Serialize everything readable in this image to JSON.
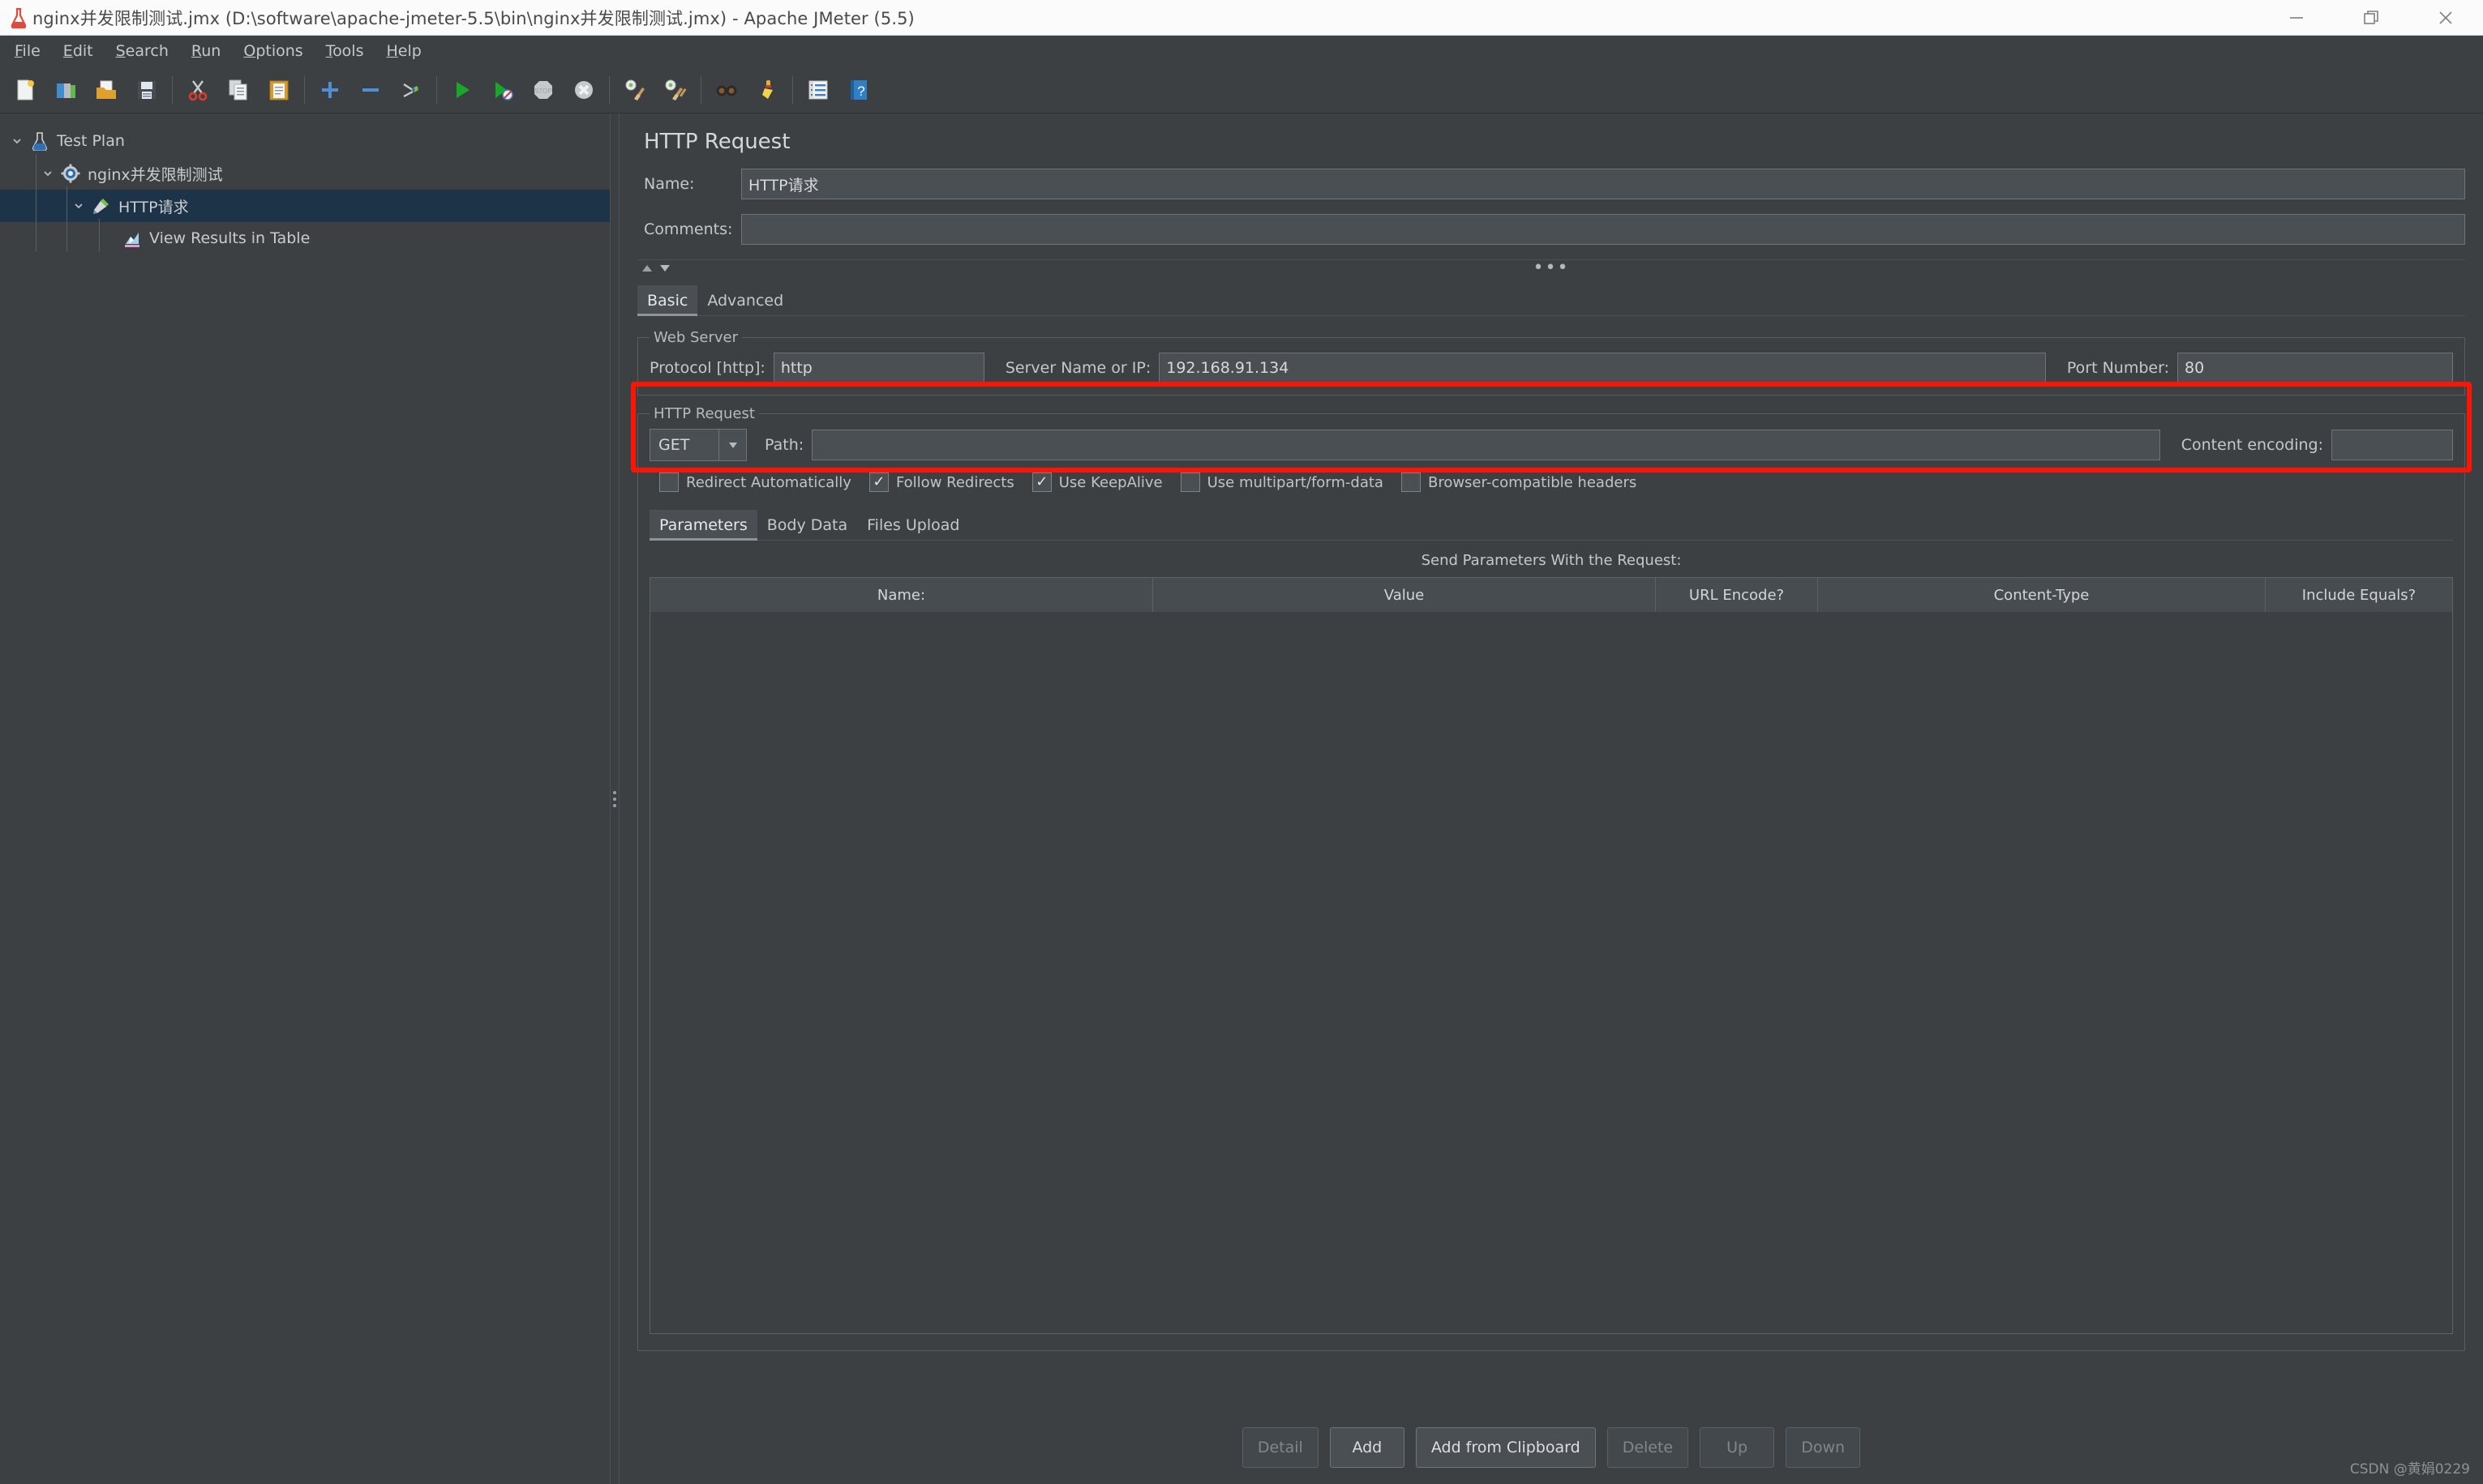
{
  "window": {
    "title": "nginx并发限制测试.jmx (D:\\software\\apache-jmeter-5.5\\bin\\nginx并发限制测试.jmx) - Apache JMeter (5.5)",
    "app_icon": "jmeter-icon",
    "controls": {
      "minimize": "minimize-icon",
      "restore": "restore-icon",
      "close": "close-icon"
    }
  },
  "menubar": {
    "items": [
      {
        "label": "File",
        "mnemonic": "F"
      },
      {
        "label": "Edit",
        "mnemonic": "E"
      },
      {
        "label": "Search",
        "mnemonic": "S"
      },
      {
        "label": "Run",
        "mnemonic": "R"
      },
      {
        "label": "Options",
        "mnemonic": "O"
      },
      {
        "label": "Tools",
        "mnemonic": "T"
      },
      {
        "label": "Help",
        "mnemonic": "H"
      }
    ]
  },
  "toolbar": {
    "groups": [
      [
        "new-test-plan-icon",
        "templates-icon",
        "open-icon",
        "save-icon"
      ],
      [
        "cut-icon",
        "copy-icon",
        "paste-icon"
      ],
      [
        "expand-all-icon",
        "collapse-all-icon",
        "toggle-icon"
      ],
      [
        "start-icon",
        "start-no-pauses-icon",
        "stop-icon",
        "shutdown-icon"
      ],
      [
        "clear-icon",
        "clear-all-icon"
      ],
      [
        "search-icon",
        "reset-search-icon"
      ],
      [
        "function-helper-icon",
        "help-icon"
      ]
    ]
  },
  "tree": {
    "nodes": [
      {
        "label": "Test Plan",
        "icon": "test-plan-icon",
        "depth": 0,
        "expanded": true,
        "selected": false
      },
      {
        "label": "nginx并发限制测试",
        "icon": "thread-group-icon",
        "depth": 1,
        "expanded": true,
        "selected": false
      },
      {
        "label": "HTTP请求",
        "icon": "http-sampler-icon",
        "depth": 2,
        "expanded": true,
        "selected": true
      },
      {
        "label": "View Results in Table",
        "icon": "view-results-table-icon",
        "depth": 3,
        "expanded": false,
        "selected": false
      }
    ]
  },
  "panel": {
    "title": "HTTP Request",
    "name_label": "Name:",
    "name_value": "HTTP请求",
    "comments_label": "Comments:",
    "comments_value": "",
    "collapse_dots": "•••",
    "tabs": [
      {
        "label": "Basic",
        "active": true
      },
      {
        "label": "Advanced",
        "active": false
      }
    ],
    "web_server": {
      "legend": "Web Server",
      "protocol_label": "Protocol [http]:",
      "protocol_value": "http",
      "server_label": "Server Name or IP:",
      "server_value": "192.168.91.134",
      "port_label": "Port Number:",
      "port_value": "80"
    },
    "http_request": {
      "legend": "HTTP Request",
      "method_value": "GET",
      "path_label": "Path:",
      "path_value": "",
      "content_encoding_label": "Content encoding:",
      "content_encoding_value": "",
      "checkboxes": [
        {
          "label": "Redirect Automatically",
          "checked": false
        },
        {
          "label": "Follow Redirects",
          "checked": true
        },
        {
          "label": "Use KeepAlive",
          "checked": true
        },
        {
          "label": "Use multipart/form-data",
          "checked": false
        },
        {
          "label": "Browser-compatible headers",
          "checked": false
        }
      ],
      "param_tabs": [
        {
          "label": "Parameters",
          "active": true
        },
        {
          "label": "Body Data",
          "active": false
        },
        {
          "label": "Files Upload",
          "active": false
        }
      ],
      "send_params_label": "Send Parameters With the Request:",
      "table_headers": [
        "Name:",
        "Value",
        "URL Encode?",
        "Content-Type",
        "Include Equals?"
      ],
      "table_rows": []
    }
  },
  "footer": {
    "buttons": [
      {
        "label": "Detail",
        "disabled": true
      },
      {
        "label": "Add",
        "disabled": false
      },
      {
        "label": "Add from Clipboard",
        "disabled": false
      },
      {
        "label": "Delete",
        "disabled": true
      },
      {
        "label": "Up",
        "disabled": true
      },
      {
        "label": "Down",
        "disabled": true
      }
    ]
  },
  "annotation": {
    "color": "#fb1507",
    "shape": "rectangle-highlight"
  },
  "watermark": "CSDN @黄娟0229"
}
